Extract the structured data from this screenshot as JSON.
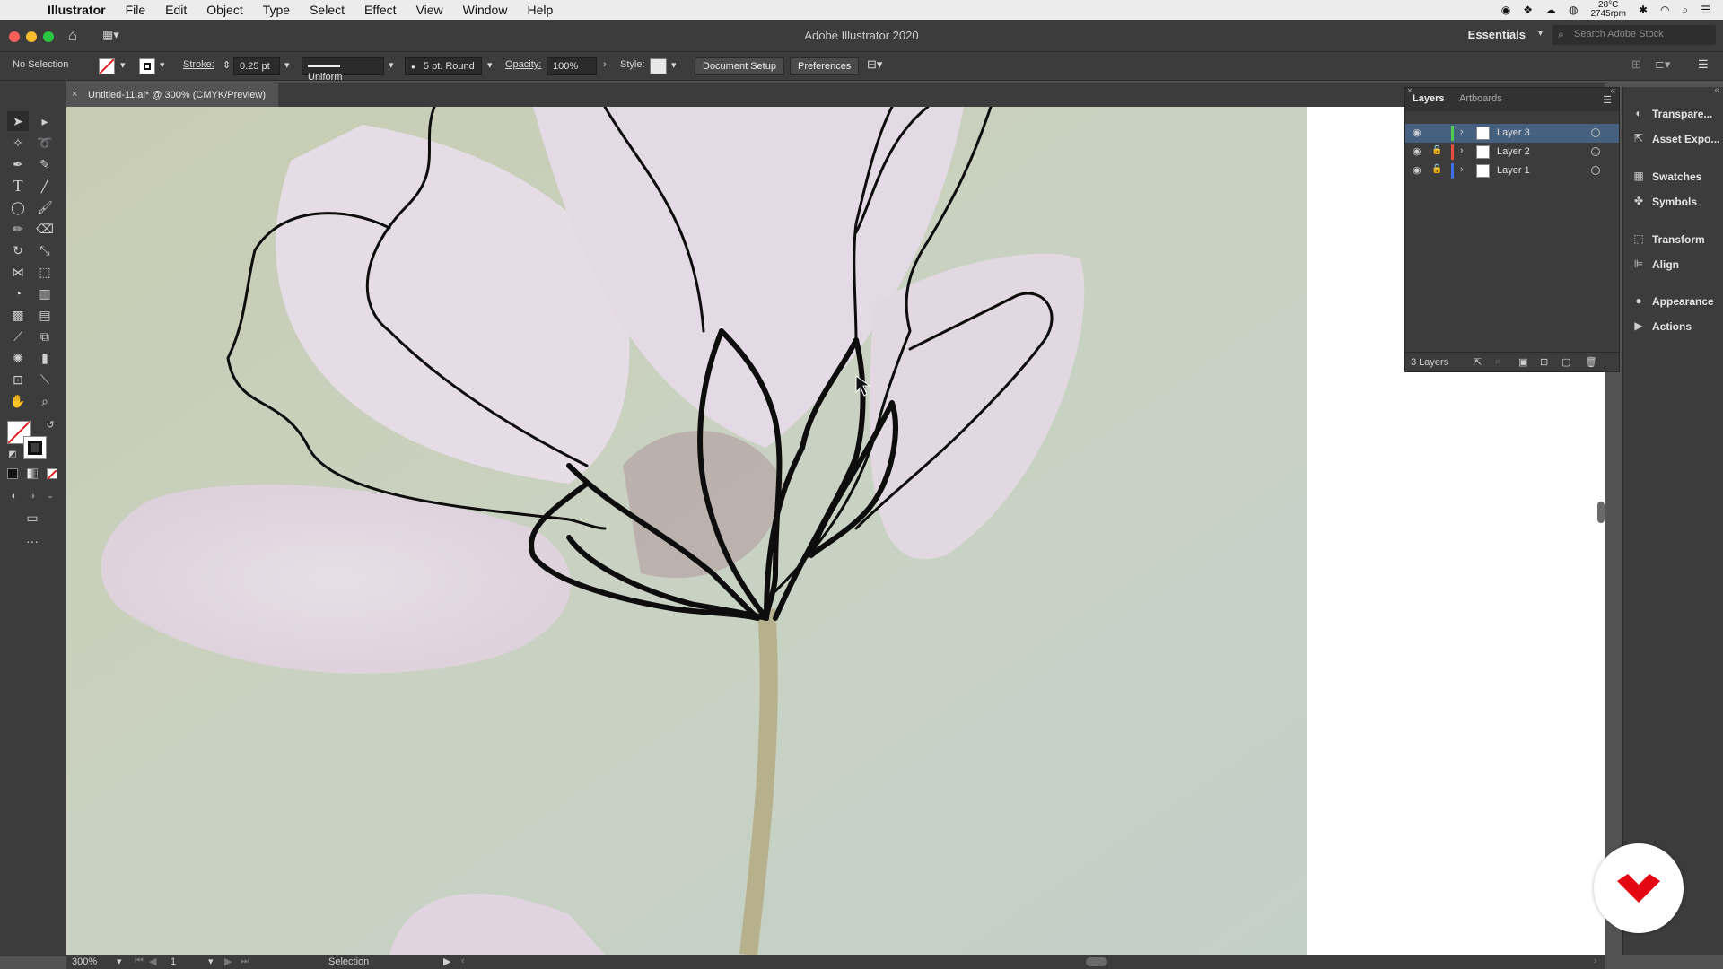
{
  "menubar": {
    "app_name": "Illustrator",
    "items": [
      "File",
      "Edit",
      "Object",
      "Type",
      "Select",
      "Effect",
      "View",
      "Window",
      "Help"
    ],
    "temperature": "28°C",
    "fan": "2745rpm"
  },
  "window": {
    "title": "Adobe Illustrator 2020",
    "workspace": "Essentials",
    "search_placeholder": "Search Adobe Stock"
  },
  "control_bar": {
    "selection": "No Selection",
    "stroke_label": "Stroke:",
    "stroke_value": "0.25 pt",
    "profile": "Uniform",
    "brush": "5 pt. Round",
    "opacity_label": "Opacity:",
    "opacity_value": "100%",
    "style_label": "Style:",
    "document_setup": "Document Setup",
    "preferences": "Preferences"
  },
  "document_tab": {
    "title": "Untitled-11.ai* @ 300% (CMYK/Preview)"
  },
  "status_bar": {
    "zoom": "300%",
    "artboard": "1",
    "tool": "Selection"
  },
  "layers_panel": {
    "tabs": [
      "Layers",
      "Artboards"
    ],
    "layers": [
      {
        "name": "Layer 3",
        "color": "#4fc94f",
        "locked": false,
        "selected": true
      },
      {
        "name": "Layer 2",
        "color": "#e84c3d",
        "locked": true,
        "selected": false
      },
      {
        "name": "Layer 1",
        "color": "#3d6fe8",
        "locked": true,
        "selected": false
      }
    ],
    "count": "3 Layers"
  },
  "dock": {
    "items": [
      "Transpare...",
      "Asset Expo...",
      "Swatches",
      "Symbols",
      "Transform",
      "Align",
      "Appearance",
      "Actions"
    ]
  },
  "colors": {
    "brand_badge": "#e30613",
    "selected_layer": "#46607f"
  }
}
